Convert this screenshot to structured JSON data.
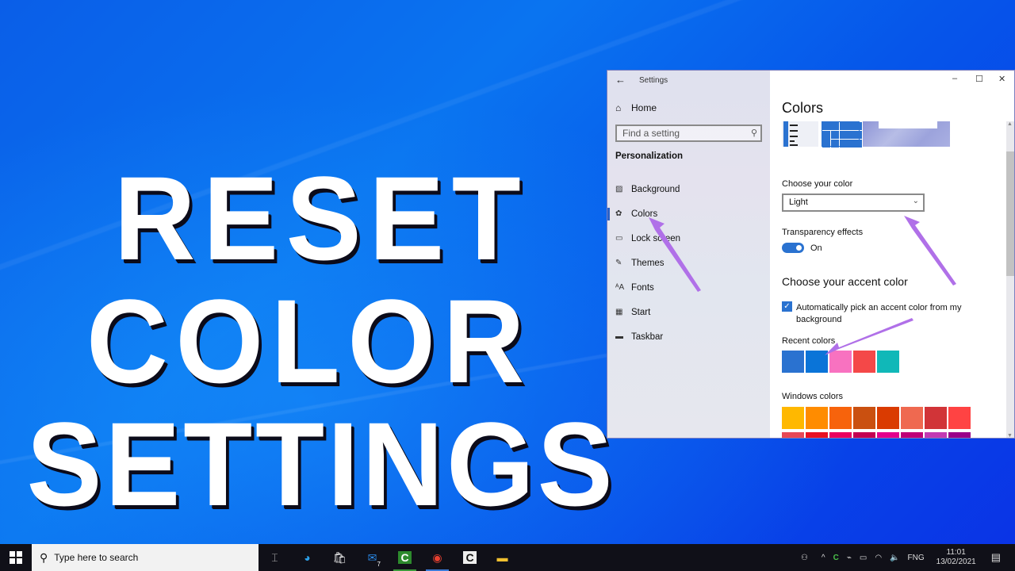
{
  "overlay": {
    "line1": "RESET",
    "line2": "COLOR",
    "line3": "SETTINGS"
  },
  "window": {
    "app_title": "Settings",
    "back_icon": "arrow-left-icon",
    "controls": {
      "minimize": "–",
      "maximize": "☐",
      "close": "✕"
    }
  },
  "sidebar": {
    "home_label": "Home",
    "search_placeholder": "Find a setting",
    "section_label": "Personalization",
    "items": [
      {
        "label": "Background",
        "icon": "picture-icon"
      },
      {
        "label": "Colors",
        "icon": "palette-icon",
        "active": true
      },
      {
        "label": "Lock screen",
        "icon": "lock-screen-icon"
      },
      {
        "label": "Themes",
        "icon": "brush-icon"
      },
      {
        "label": "Fonts",
        "icon": "fonts-icon"
      },
      {
        "label": "Start",
        "icon": "start-icon"
      },
      {
        "label": "Taskbar",
        "icon": "taskbar-icon"
      }
    ]
  },
  "main": {
    "title": "Colors",
    "choose_color_label": "Choose your color",
    "choose_color_value": "Light",
    "transparency_label": "Transparency effects",
    "transparency_value": "On",
    "accent_heading": "Choose your accent color",
    "auto_pick_label": "Automatically pick an accent color from my background",
    "auto_pick_checked": true,
    "recent_colors_label": "Recent colors",
    "recent_colors": [
      "#2a72d0",
      "#0a74d8",
      "#f872c0",
      "#f44848",
      "#10b8b8"
    ],
    "windows_colors_label": "Windows colors",
    "windows_colors_row1": [
      "#ffb800",
      "#ff8c00",
      "#f7630c",
      "#ca5010",
      "#da3b01",
      "#ef6950",
      "#d13438",
      "#ff4343"
    ],
    "windows_colors_row2": [
      "#e74856",
      "#e81123",
      "#ea005e",
      "#c30052",
      "#e3008c",
      "#bf0077",
      "#c239b3",
      "#9a0089"
    ]
  },
  "taskbar": {
    "search_placeholder": "Type here to search",
    "apps": [
      "task-view",
      "edge",
      "store",
      "mail",
      "camtasia-recorder",
      "chrome",
      "camtasia",
      "file-explorer"
    ],
    "mail_badge": "7",
    "tray": {
      "language": "FNG",
      "time": "11:01",
      "date": "13/02/2021"
    }
  }
}
